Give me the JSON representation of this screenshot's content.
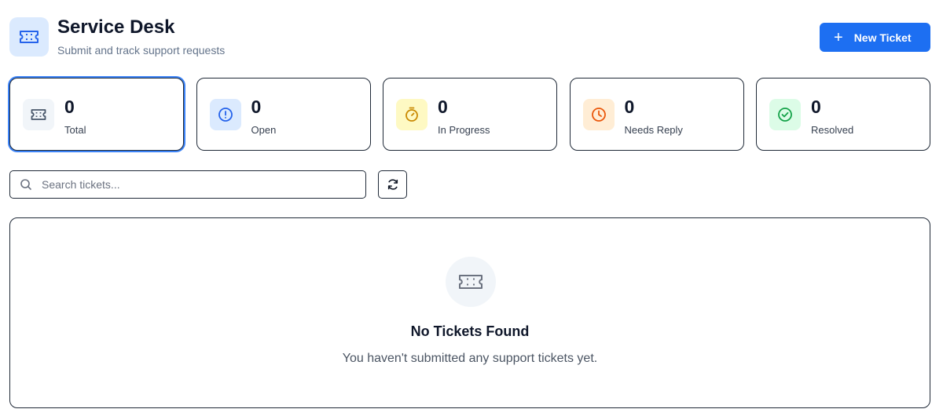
{
  "header": {
    "title": "Service Desk",
    "subtitle": "Submit and track support requests",
    "new_ticket_label": "New Ticket",
    "icon": "ticket-icon"
  },
  "stats": [
    {
      "value": "0",
      "label": "Total",
      "icon": "ticket-icon",
      "color": "#475569",
      "bg": "#f1f5f9",
      "active": true
    },
    {
      "value": "0",
      "label": "Open",
      "icon": "alert-circle-icon",
      "color": "#2563eb",
      "bg": "#dbeafe"
    },
    {
      "value": "0",
      "label": "In Progress",
      "icon": "timer-icon",
      "color": "#ca8a04",
      "bg": "#fef9c3"
    },
    {
      "value": "0",
      "label": "Needs Reply",
      "icon": "clock-icon",
      "color": "#ea580c",
      "bg": "#ffedd5"
    },
    {
      "value": "0",
      "label": "Resolved",
      "icon": "check-circle-icon",
      "color": "#16a34a",
      "bg": "#dcfce7"
    }
  ],
  "search": {
    "placeholder": "Search tickets...",
    "value": ""
  },
  "empty_state": {
    "title": "No Tickets Found",
    "message": "You haven't submitted any support tickets yet."
  },
  "colors": {
    "accent": "#1d6ff2",
    "active_ring": "#3b82f6"
  }
}
